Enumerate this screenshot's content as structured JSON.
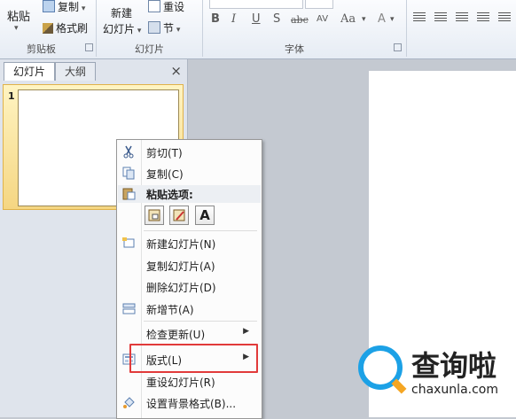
{
  "ribbon": {
    "clipboard": {
      "paste": "粘贴",
      "copy": "复制",
      "format_painter": "格式刷",
      "group_label": "剪贴板"
    },
    "slides": {
      "new_slide_line1": "新建",
      "new_slide_line2": "幻灯片",
      "reset": "重设",
      "section": "节",
      "group_label": "幻灯片"
    },
    "font": {
      "bold": "B",
      "italic": "I",
      "underline": "U",
      "strike": "S",
      "abc": "abc",
      "spacing": "AV",
      "case": "Aa",
      "color": "A",
      "group_label": "字体"
    }
  },
  "pane": {
    "tab_slides": "幻灯片",
    "tab_outline": "大纲",
    "close": "×",
    "slide_number": "1"
  },
  "context_menu": {
    "cut": "剪切(T)",
    "copy": "复制(C)",
    "paste_options": "粘贴选项:",
    "paste_text_keep": "A",
    "new_slide": "新建幻灯片(N)",
    "duplicate_slide": "复制幻灯片(A)",
    "delete_slide": "删除幻灯片(D)",
    "add_section": "新增节(A)",
    "check_updates": "检查更新(U)",
    "layout": "版式(L)",
    "reset_slide": "重设幻灯片(R)",
    "format_background": "设置背景格式(B)..."
  },
  "watermark": {
    "text": "查询啦",
    "url": "chaxunla.com"
  },
  "colors": {
    "highlight": "#e13a3a",
    "selected_thumb": "#f5d682",
    "watermark_blue": "#1ca1e6"
  }
}
